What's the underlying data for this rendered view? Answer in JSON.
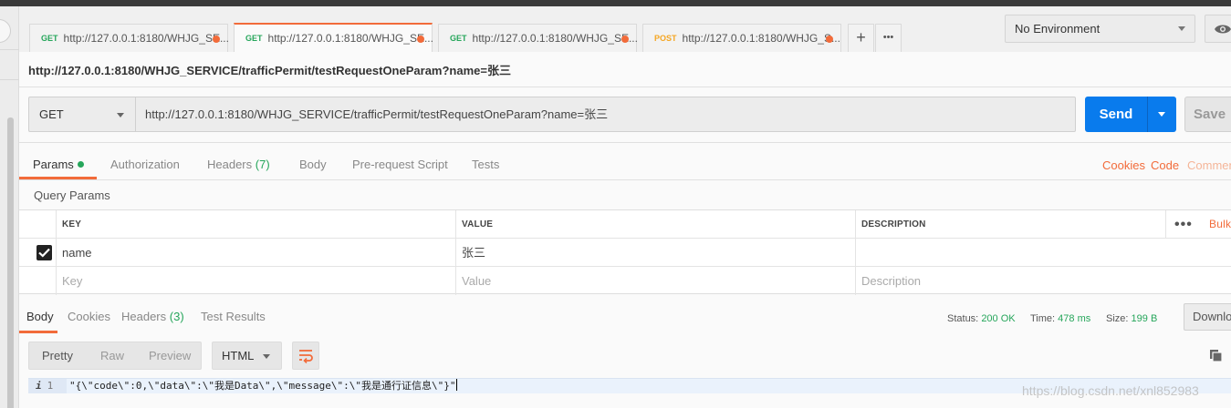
{
  "tabs": [
    {
      "method": "GET",
      "url": "http://127.0.0.1:8180/WHJG_SE..."
    },
    {
      "method": "GET",
      "url": "http://127.0.0.1:8180/WHJG_SE..."
    },
    {
      "method": "GET",
      "url": "http://127.0.0.1:8180/WHJG_SE..."
    },
    {
      "method": "POST",
      "url": "http://127.0.0.1:8180/WHJG_S..."
    }
  ],
  "tab_plus": "+",
  "tab_more": "•••",
  "environment": "No Environment",
  "request_title": "http://127.0.0.1:8180/WHJG_SERVICE/trafficPermit/testRequestOneParam?name=张三",
  "request": {
    "method": "GET",
    "url": "http://127.0.0.1:8180/WHJG_SERVICE/trafficPermit/testRequestOneParam?name=张三",
    "send_label": "Send",
    "save_label": "Save"
  },
  "request_tabs": {
    "params": "Params",
    "authorization": "Authorization",
    "headers": "Headers",
    "headers_count": "(7)",
    "body": "Body",
    "prerequest": "Pre-request Script",
    "tests": "Tests",
    "cookies": "Cookies",
    "code": "Code",
    "comments": "Commen"
  },
  "query_params_label": "Query Params",
  "params_table": {
    "headers": {
      "key": "KEY",
      "value": "VALUE",
      "description": "DESCRIPTION",
      "bulk": "Bulk"
    },
    "rows": [
      {
        "key": "name",
        "value": "张三",
        "description": ""
      }
    ],
    "placeholders": {
      "key": "Key",
      "value": "Value",
      "description": "Description"
    }
  },
  "response_tabs": {
    "body": "Body",
    "cookies": "Cookies",
    "headers": "Headers",
    "headers_count": "(3)",
    "test_results": "Test Results"
  },
  "response_meta": {
    "status_label": "Status:",
    "status": "200 OK",
    "time_label": "Time:",
    "time": "478 ms",
    "size_label": "Size:",
    "size": "199 B",
    "download": "Downlo"
  },
  "format": {
    "pretty": "Pretty",
    "raw": "Raw",
    "preview": "Preview",
    "language": "HTML"
  },
  "code": {
    "line_number": "1",
    "info_icon": "i",
    "text": "\"{\\\"code\\\":0,\\\"data\\\":\\\"我是Data\\\",\\\"message\\\":\\\"我是通行证信息\\\"}\""
  },
  "watermark": "https://blog.csdn.net/xnl852983",
  "colors": {
    "accent": "#f26b3a",
    "send": "#097bed",
    "success": "#26a65b",
    "post": "#f5a623"
  }
}
